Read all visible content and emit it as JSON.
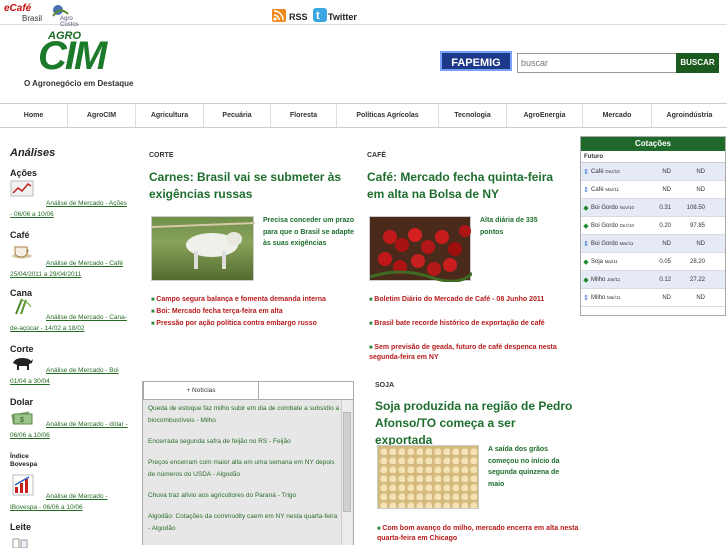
{
  "topbar": {
    "ecafe": "eCafé",
    "ecafe_sub": "Brasil",
    "agrolink": "Agro Custos",
    "rss": "RSS",
    "twitter": "Twitter"
  },
  "logo": {
    "agro": "AGRO",
    "cim": "CIM",
    "slogan": "O Agronegócio em Destaque"
  },
  "header": {
    "fapemig": "FAPEMIG",
    "search_placeholder": "buscar",
    "search_btn": "BUSCAR"
  },
  "nav": [
    "Home",
    "AgroCIM",
    "Agricultura",
    "Pecuária",
    "Floresta",
    "Políticas Agrícolas",
    "Tecnologia",
    "AgroEnergia",
    "Mercado",
    "Agroindústria"
  ],
  "sidebar": {
    "title": "Análises",
    "items": [
      {
        "cat": "Ações",
        "link": "Análise de Mercado - Ações - 06/06 a 10/06"
      },
      {
        "cat": "Café",
        "link": "Análise de Mercado - Café 25/04/2011 a 29/04/2011"
      },
      {
        "cat": "Cana",
        "link": "Análise de Mercado - Cana-de-açúcar - 14/02 a 18/02"
      },
      {
        "cat": "Corte",
        "link": "Análise de Mercado - Boi 01/04 a 30/04"
      },
      {
        "cat": "Dolar",
        "link": "Análise de Mercado - dólar - 06/06 a 10/06"
      },
      {
        "cat": "Índice Bovespa",
        "link": "Análise de Mercado - IBovespa - 06/06 a 10/06"
      },
      {
        "cat": "Leite",
        "link": ""
      }
    ]
  },
  "articles": {
    "corte": {
      "section": "CORTE",
      "title": "Carnes: Brasil vai se submeter às exigências russas",
      "caption": "Precisa conceder um prazo para que o Brasil se adapte às suas exigências",
      "bullets": [
        "Campo segura balança e fomenta demanda interna",
        "Boi: Mercado fecha terça-feira em alta",
        "Pressão por ação política contra embargo russo"
      ]
    },
    "cafe": {
      "section": "CAFÉ",
      "title": "Café: Mercado fecha quinta-feira em alta na Bolsa de NY",
      "caption": "Alta diária de 335 pontos",
      "bullets": [
        "Boletim Diário do Mercado de Café - 08 Junho 2011",
        "Brasil bate recorde histórico de exportação de café",
        "Sem previsão de geada, futuro de café despenca nesta segunda-feira em NY"
      ]
    },
    "soja": {
      "section": "SOJA",
      "title": "Soja produzida na região de Pedro Afonso/TO começa a ser exportada",
      "caption": "A saída dos grãos começou no início da segunda quinzena de maio",
      "bullets": [
        "Com bom avanço do milho, mercado encerra em alta nesta quarta-feira em Chicago"
      ]
    }
  },
  "cotacoes": {
    "title": "Cotações",
    "subtitle": "Futuro",
    "rows": [
      {
        "name": "Café",
        "month": "Dez/10",
        "v1": "ND",
        "v2": "ND",
        "icon": "arrow-updown"
      },
      {
        "name": "Café",
        "month": "Mar/11",
        "v1": "ND",
        "v2": "ND",
        "icon": "arrow-updown"
      },
      {
        "name": "Boi Gordo",
        "month": "Nov/10",
        "v1": "0.31",
        "v2": "108.50",
        "icon": "diamond-up"
      },
      {
        "name": "Boi Gordo",
        "month": "Dez/10",
        "v1": "0.20",
        "v2": "97.85",
        "icon": "diamond-up"
      },
      {
        "name": "Boi Gordo",
        "month": "Mar/11",
        "v1": "ND",
        "v2": "ND",
        "icon": "arrow-updown"
      },
      {
        "name": "Soja",
        "month": "Mai/11",
        "v1": "0.05",
        "v2": "28.20",
        "icon": "diamond-up"
      },
      {
        "name": "Milho",
        "month": "Jan/11",
        "v1": "0.12",
        "v2": "27.22",
        "icon": "diamond-up"
      },
      {
        "name": "Milho",
        "month": "Mar/11",
        "v1": "ND",
        "v2": "ND",
        "icon": "arrow-updown"
      }
    ]
  },
  "noticias": {
    "tab": "+ Notícias",
    "items": [
      "Queda de estoque faz milho subir em dia de combate a subsídio a biocombustíveis - Milho",
      "Encerrada segunda safra de feijão no RS - Feijão",
      "Preços encerram com maior alta em uma semana em NY depois de números do USDA - Algodão",
      "Chuva traz alívio aos agricultores do Paraná - Trigo",
      "Algodão: Cotações da commodity caem em NY nesta quarta-feira - Algodão"
    ]
  },
  "colors": {
    "brand_green": "#1d6e2e",
    "bullet_red": "#b81a1a",
    "cot_header": "#1f6a2a"
  }
}
